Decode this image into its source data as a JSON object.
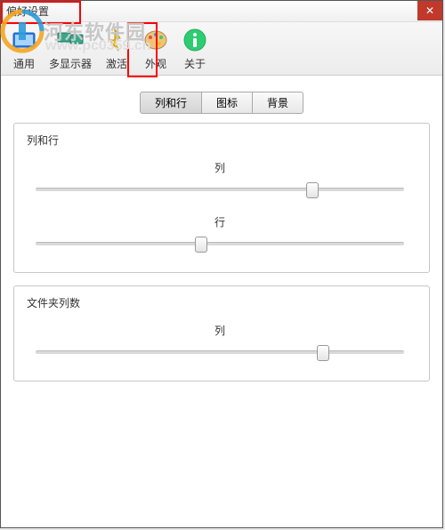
{
  "window": {
    "title": "偏好设置"
  },
  "toolbar": {
    "items": [
      {
        "label": "通用"
      },
      {
        "label": "多显示器"
      },
      {
        "label": "激活"
      },
      {
        "label": "外观"
      },
      {
        "label": "关于"
      }
    ]
  },
  "tabs": {
    "items": [
      {
        "label": "列和行",
        "active": true
      },
      {
        "label": "图标",
        "active": false
      },
      {
        "label": "背景",
        "active": false
      }
    ]
  },
  "panels": [
    {
      "title": "列和行",
      "sliders": [
        {
          "label": "列",
          "position": 75
        },
        {
          "label": "行",
          "position": 45
        }
      ]
    },
    {
      "title": "文件夹列数",
      "sliders": [
        {
          "label": "列",
          "position": 78
        }
      ]
    }
  ],
  "watermark": {
    "text": "河东软件园",
    "url": "www.pc0359.cn"
  }
}
